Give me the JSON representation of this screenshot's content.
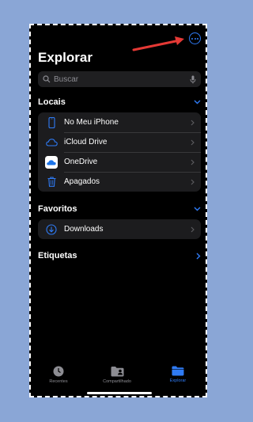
{
  "header": {
    "title": "Explorar",
    "more_icon": "ellipsis-circle-icon"
  },
  "annotation": {
    "arrow_color": "#e53935"
  },
  "search": {
    "placeholder": "Buscar"
  },
  "sections": {
    "locais": {
      "label": "Locais",
      "items": [
        {
          "label": "No Meu iPhone",
          "icon": "iphone-icon"
        },
        {
          "label": "iCloud Drive",
          "icon": "icloud-icon"
        },
        {
          "label": "OneDrive",
          "icon": "onedrive-icon"
        },
        {
          "label": "Apagados",
          "icon": "trash-icon"
        }
      ]
    },
    "favoritos": {
      "label": "Favoritos",
      "items": [
        {
          "label": "Downloads",
          "icon": "download-circle-icon"
        }
      ]
    },
    "etiquetas": {
      "label": "Etiquetas"
    }
  },
  "tabbar": {
    "tabs": [
      {
        "label": "Recentes",
        "icon": "clock-icon",
        "active": false
      },
      {
        "label": "Compartilhado",
        "icon": "shared-folder-icon",
        "active": false
      },
      {
        "label": "Explorar",
        "icon": "folder-icon",
        "active": true
      }
    ]
  },
  "colors": {
    "accent": "#2f7bf5",
    "background": "#000000",
    "group_bg": "#1c1c1e"
  }
}
